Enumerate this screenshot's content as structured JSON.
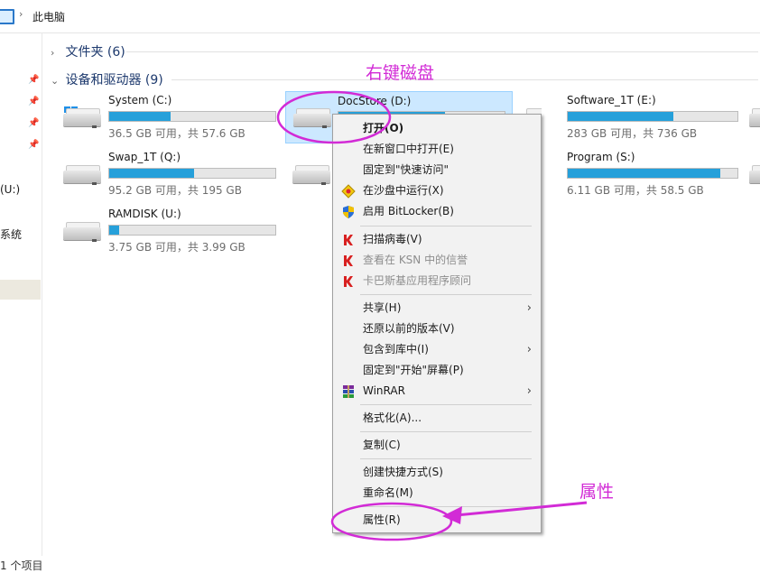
{
  "address": {
    "crumb": "此电脑"
  },
  "nav": {
    "items": [
      "(U:)",
      "系统"
    ]
  },
  "groups": {
    "folders": "文件夹 (6)",
    "drives": "设备和驱动器 (9)"
  },
  "drives": [
    {
      "name": "System (C:)",
      "info": "36.5 GB 可用，共 57.6 GB",
      "used_fraction": 0.37,
      "icon": "windows-drive-icon"
    },
    {
      "name": "DocStore (D:)",
      "info": "",
      "used_fraction": 0.64,
      "icon": "drive-icon",
      "selected": true
    },
    {
      "name": "Software_1T (E:)",
      "info": "283 GB 可用，共 736 GB",
      "used_fraction": 0.62,
      "icon": "drive-icon"
    },
    {
      "name": "Swap_1T (Q:)",
      "info": "95.2 GB 可用，共 195 GB",
      "used_fraction": 0.51,
      "icon": "drive-icon"
    },
    {
      "name": "Program (S:)",
      "info": "6.11 GB 可用，共 58.5 GB",
      "used_fraction": 0.9,
      "icon": "drive-icon"
    },
    {
      "name": "RAMDISK (U:)",
      "info": "3.75 GB 可用，共 3.99 GB",
      "used_fraction": 0.06,
      "icon": "drive-icon"
    }
  ],
  "status": {
    "count": "1 个项目"
  },
  "context_menu": {
    "items": [
      {
        "label": "打开(O)",
        "bold": true
      },
      {
        "label": "在新窗口中打开(E)"
      },
      {
        "label": "固定到\"快速访问\""
      },
      {
        "label": "在沙盘中运行(X)",
        "icon": "sandbox-icon"
      },
      {
        "label": "启用 BitLocker(B)",
        "icon": "shield-icon"
      },
      {
        "label": "扫描病毒(V)",
        "icon": "kaspersky-icon"
      },
      {
        "label": "查看在 KSN 中的信誉",
        "icon": "kaspersky-icon",
        "disabled": true
      },
      {
        "label": "卡巴斯基应用程序顾问",
        "icon": "kaspersky-icon",
        "disabled": true
      },
      {
        "label": "共享(H)",
        "submenu": true
      },
      {
        "label": "还原以前的版本(V)"
      },
      {
        "label": "包含到库中(I)",
        "submenu": true
      },
      {
        "label": "固定到\"开始\"屏幕(P)"
      },
      {
        "label": "WinRAR",
        "icon": "winrar-icon",
        "submenu": true
      },
      {
        "label": "格式化(A)..."
      },
      {
        "label": "复制(C)"
      },
      {
        "label": "创建快捷方式(S)"
      },
      {
        "label": "重命名(M)"
      },
      {
        "label": "属性(R)"
      }
    ]
  },
  "annotations": {
    "right_click": "右键磁盘",
    "properties": "属性",
    "color": "#d22bd6"
  }
}
